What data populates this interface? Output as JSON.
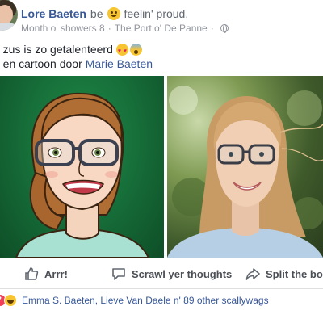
{
  "post": {
    "author": "Lore Baeten",
    "verb": "be",
    "feeling": "feelin' proud.",
    "date": "Month o' showers 8",
    "separator": "·",
    "location": "The Port o' De Panne",
    "separator2": "·",
    "text_line1": "n zus is zo getalenteerd",
    "text_line2_prefix": "o en cartoon door",
    "text_link": "Marie Baeten"
  },
  "actions": {
    "like": "Arrr!",
    "comment": "Scrawl yer thoughts",
    "share": "Split the boot"
  },
  "reactions": {
    "names": "Emma S. Baeten, Lieve Van Daele n' 89 other scallywags"
  },
  "icons": [
    "smile-emoji-icon",
    "globe-icon",
    "heart-eyes-emoji-icon",
    "scream-emoji-icon",
    "thumbs-up-icon",
    "comment-icon",
    "share-icon",
    "heart-reaction-icon",
    "laugh-reaction-icon"
  ],
  "colors": {
    "link": "#385898",
    "meta": "#90949c",
    "action": "#4b4f56"
  }
}
